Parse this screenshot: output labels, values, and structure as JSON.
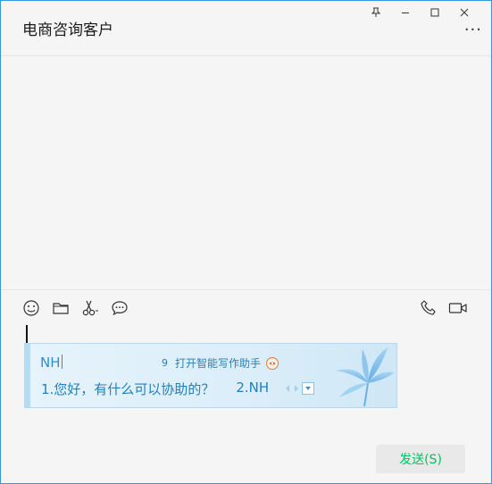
{
  "window": {
    "title": "电商咨询客户",
    "more_glyph": "···"
  },
  "toolbar": {
    "left_icons": [
      "emoji-icon",
      "folder-icon",
      "scissors-icon",
      "chat-bubble-icon"
    ],
    "right_icons": [
      "phone-icon",
      "video-icon"
    ]
  },
  "ime": {
    "input": "NH",
    "hint_num": "9",
    "hint_text": "打开智能写作助手",
    "candidates": [
      "1.您好，有什么可以协助的？",
      "2.NH"
    ]
  },
  "send": {
    "label": "发送(S)"
  },
  "colors": {
    "accent": "#07c160",
    "border": "#2f9adf",
    "ime_text": "#2d8fd0"
  }
}
